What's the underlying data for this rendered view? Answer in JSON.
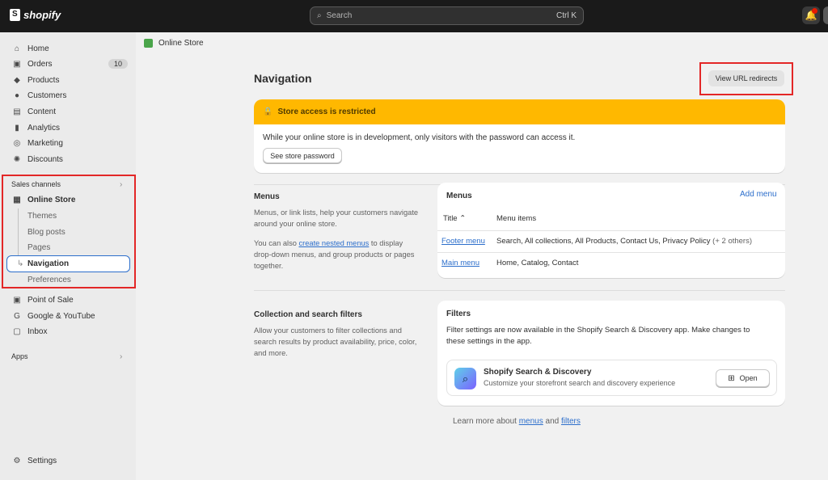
{
  "app": {
    "brand": "shopify"
  },
  "search": {
    "placeholder": "Search",
    "shortcut": "Ctrl K"
  },
  "sidebar": {
    "items": [
      {
        "label": "Home",
        "icon": "home-icon"
      },
      {
        "label": "Orders",
        "icon": "orders-icon",
        "badge": "10"
      },
      {
        "label": "Products",
        "icon": "tag-icon"
      },
      {
        "label": "Customers",
        "icon": "person-icon"
      },
      {
        "label": "Content",
        "icon": "content-icon"
      },
      {
        "label": "Analytics",
        "icon": "bar-chart-icon"
      },
      {
        "label": "Marketing",
        "icon": "target-icon"
      },
      {
        "label": "Discounts",
        "icon": "discount-icon"
      }
    ],
    "sales_channels_label": "Sales channels",
    "online_store": {
      "label": "Online Store",
      "subitems": [
        "Themes",
        "Blog posts",
        "Pages",
        "Navigation",
        "Preferences"
      ]
    },
    "channels": [
      {
        "label": "Point of Sale",
        "icon": "pos-icon"
      },
      {
        "label": "Google & YouTube",
        "icon": "google-icon"
      },
      {
        "label": "Inbox",
        "icon": "inbox-icon"
      }
    ],
    "apps_label": "Apps",
    "settings_label": "Settings"
  },
  "breadcrumb": {
    "label": "Online Store"
  },
  "page": {
    "title": "Navigation",
    "redirects_button": "View URL redirects"
  },
  "banner": {
    "title": "Store access is restricted",
    "text": "While your online store is in development, only visitors with the password can access it.",
    "button": "See store password",
    "color": "#ffb800"
  },
  "menus_section": {
    "title": "Menus",
    "description": "Menus, or link lists, help your customers navigate around your online store.",
    "text_before_link": "You can also ",
    "link_text": "create nested menus",
    "text_after_link": " to display drop-down menus, and group products or pages together."
  },
  "menus_card": {
    "title": "Menus",
    "add_label": "Add menu",
    "columns": [
      "Title",
      "Menu items"
    ],
    "rows": [
      {
        "title": "Footer menu",
        "items": "Search, All collections, All Products, Contact Us, Privacy Policy",
        "extra": "(+ 2 others)"
      },
      {
        "title": "Main menu",
        "items": "Home, Catalog, Contact",
        "extra": ""
      }
    ]
  },
  "filters_section": {
    "title": "Collection and search filters",
    "description": "Allow your customers to filter collections and search results by product availability, price, color, and more."
  },
  "filters_card": {
    "title": "Filters",
    "text": "Filter settings are now available in the Shopify Search & Discovery app. Make changes to these settings in the app.",
    "app_name": "Shopify Search & Discovery",
    "app_desc": "Customize your storefront search and discovery experience",
    "open_label": "Open"
  },
  "footer": {
    "text": "Learn more about ",
    "link1": "menus",
    "and": " and ",
    "link2": "filters"
  },
  "colors": {
    "accent": "#2c6ecb",
    "highlight": "#e32727"
  }
}
